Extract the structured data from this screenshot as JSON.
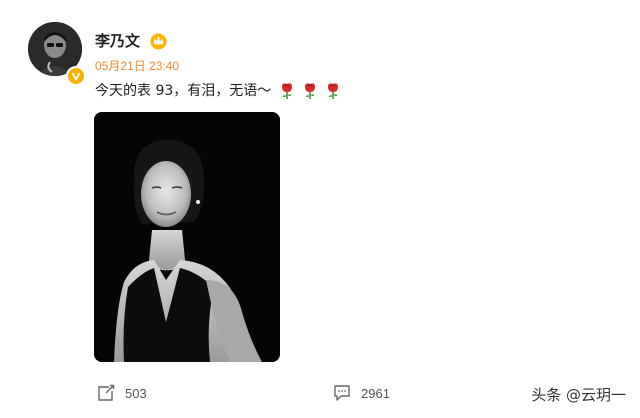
{
  "user": {
    "name": "李乃文",
    "avatar_icon": "avatar-photo-icon",
    "verified_icon": "verified-v-icon",
    "member_icon": "crown-icon"
  },
  "post": {
    "timestamp": "05月21日 23:40",
    "text": "今天的表 93，有泪，无语～",
    "emoji": [
      "rose-icon",
      "rose-icon",
      "rose-icon"
    ],
    "image_icon": "portrait-photo-icon"
  },
  "actions": {
    "share_count": "503",
    "comment_count": "2961"
  },
  "watermark": "头条 @云玥一",
  "colors": {
    "timestamp": "#f08a2e",
    "verified": "#f6b200",
    "rose": "#d42a2a"
  }
}
